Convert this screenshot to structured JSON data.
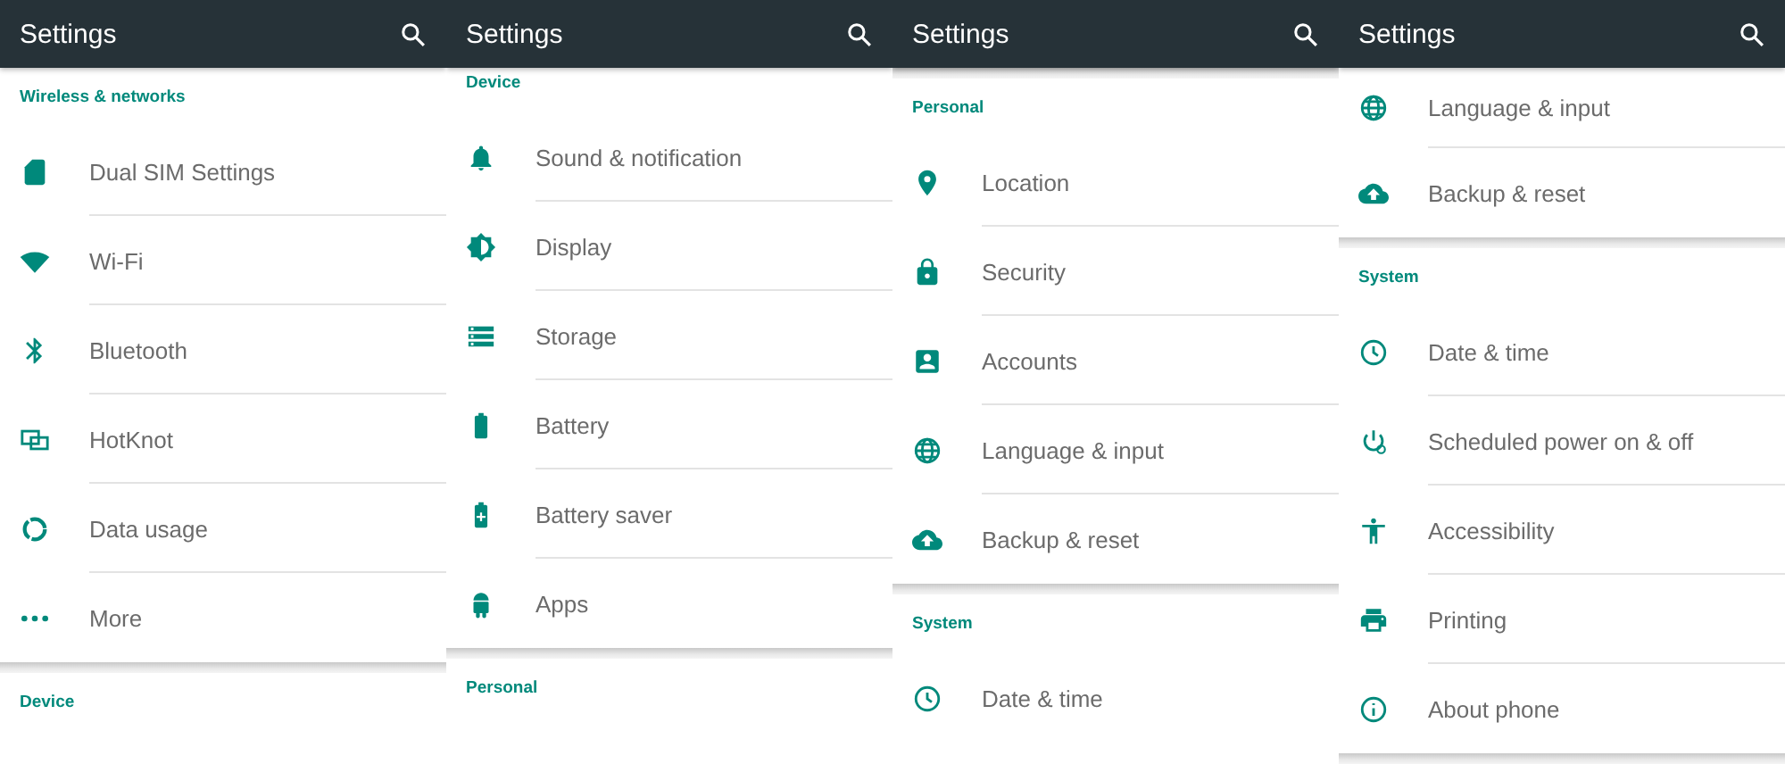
{
  "screens": [
    {
      "title": "Settings",
      "top_divider": false,
      "list_end": false,
      "sections": [
        {
          "header": "Wireless & networks",
          "items": [
            {
              "label": "Dual SIM Settings",
              "kind": "sim"
            },
            {
              "label": "Wi-Fi",
              "kind": "wifi"
            },
            {
              "label": "Bluetooth",
              "kind": "bluetooth"
            },
            {
              "label": "HotKnot",
              "kind": "hotknot"
            },
            {
              "label": "Data usage",
              "kind": "data"
            },
            {
              "label": "More",
              "kind": "more"
            }
          ]
        },
        {
          "header": "Device"
        }
      ]
    },
    {
      "title": "Settings",
      "top_divider": false,
      "list_end": false,
      "sections": [
        {
          "header": "Device",
          "items": [
            {
              "label": "Sound & notification",
              "kind": "bell"
            },
            {
              "label": "Display",
              "kind": "display"
            },
            {
              "label": "Storage",
              "kind": "storage"
            },
            {
              "label": "Battery",
              "kind": "battery"
            },
            {
              "label": "Battery saver",
              "kind": "battery-saver"
            },
            {
              "label": "Apps",
              "kind": "android"
            }
          ]
        },
        {
          "header": "Personal"
        }
      ]
    },
    {
      "title": "Settings",
      "top_divider": true,
      "list_end": false,
      "sections": [
        {
          "header": "Personal",
          "items": [
            {
              "label": "Location",
              "kind": "location"
            },
            {
              "label": "Security",
              "kind": "lock"
            },
            {
              "label": "Accounts",
              "kind": "account"
            },
            {
              "label": "Language & input",
              "kind": "globe"
            },
            {
              "label": "Backup & reset",
              "kind": "cloud"
            }
          ]
        },
        {
          "header": "System",
          "items": [
            {
              "label": "Date & time",
              "kind": "clock"
            }
          ]
        }
      ]
    },
    {
      "title": "Settings",
      "top_divider": false,
      "list_end": true,
      "sections": [
        {
          "items": [
            {
              "label": "Language & input",
              "kind": "globe"
            },
            {
              "label": "Backup & reset",
              "kind": "cloud"
            }
          ]
        },
        {
          "header": "System",
          "items": [
            {
              "label": "Date & time",
              "kind": "clock"
            },
            {
              "label": "Scheduled power on & off",
              "kind": "power"
            },
            {
              "label": "Accessibility",
              "kind": "accessibility"
            },
            {
              "label": "Printing",
              "kind": "printer"
            },
            {
              "label": "About phone",
              "kind": "info"
            }
          ]
        }
      ]
    }
  ]
}
